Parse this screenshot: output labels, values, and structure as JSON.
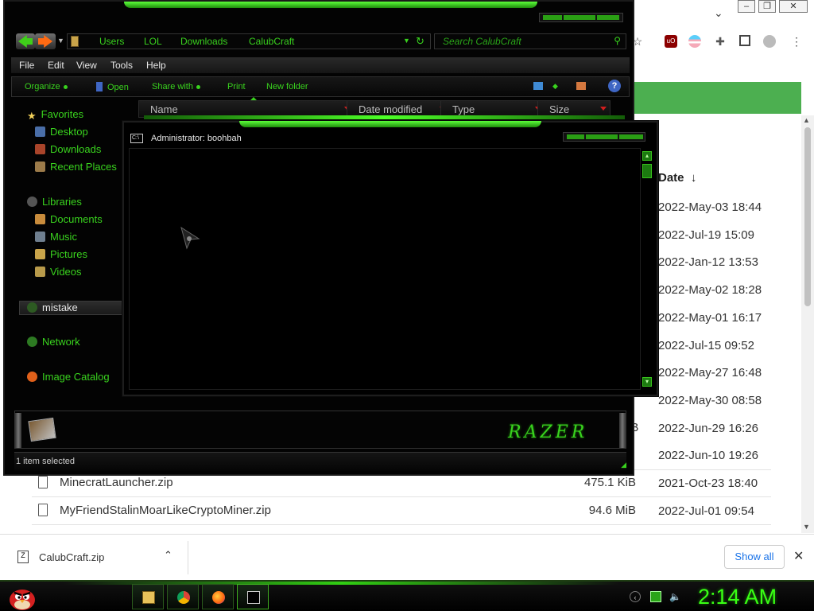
{
  "browser": {
    "tab_overflow_icon": "chevron-down-icon",
    "window_controls": [
      "minimize",
      "restore",
      "close"
    ],
    "extensions": [
      "star-icon",
      "ublock-icon",
      "pride-flag-icon",
      "puzzle-icon",
      "sidepanel-icon",
      "profile-icon",
      "more-icon"
    ],
    "accent_color": "#4caf50",
    "table_header_date": "Date",
    "sort_indicator": "↓",
    "dates": [
      "2022-May-03 18:44",
      "2022-Jul-19 15:09",
      "2022-Jan-12 13:53",
      "2022-May-02 18:28",
      "2022-May-01 16:17",
      "2022-Jul-15 09:52",
      "2022-May-27 16:48",
      "2022-May-30 08:58",
      "2022-Jun-29 16:26",
      "2022-Jun-10 19:26",
      "2021-Oct-23 18:40",
      "2022-Jul-01 09:54"
    ],
    "size_fragment": "iB",
    "files": [
      {
        "name": "MinecratLauncher.zip",
        "size": "475.1 KiB"
      },
      {
        "name": "MyFriendStalinMoarLikeCryptoMiner.zip",
        "size": "94.6 MiB"
      }
    ]
  },
  "download_bar": {
    "file_name": "CalubCraft.zip",
    "show_all": "Show all",
    "close": "✕",
    "chevron": "⌃"
  },
  "explorer": {
    "breadcrumbs": [
      "Users",
      "LOL",
      "Downloads",
      "CalubCraft"
    ],
    "search_placeholder": "Search CalubCraft",
    "menu": [
      "File",
      "Edit",
      "View",
      "Tools",
      "Help"
    ],
    "commands": [
      "Organize",
      "Open",
      "Share with",
      "Print",
      "New folder"
    ],
    "help": "?",
    "nav": {
      "favorites": "Favorites",
      "desktop": "Desktop",
      "downloads": "Downloads",
      "recent": "Recent Places",
      "libraries": "Libraries",
      "documents": "Documents",
      "music": "Music",
      "pictures": "Pictures",
      "videos": "Videos",
      "mistake": "mistake",
      "network": "Network",
      "image_catalog": "Image Catalog"
    },
    "columns": [
      "Name",
      "Date modified",
      "Type",
      "Size"
    ],
    "status": "1 item selected",
    "brand_logo": "RAZER",
    "accent_color": "#39d21e"
  },
  "console": {
    "title": "Administrator:  boohbah",
    "icon_label": "C:\\"
  },
  "taskbar": {
    "clock": "2:14 AM",
    "pinned": [
      "explorer-icon",
      "chrome-icon",
      "firefox-icon",
      "console-icon"
    ],
    "tray": [
      "back-icon",
      "network-icon",
      "volume-icon"
    ]
  }
}
